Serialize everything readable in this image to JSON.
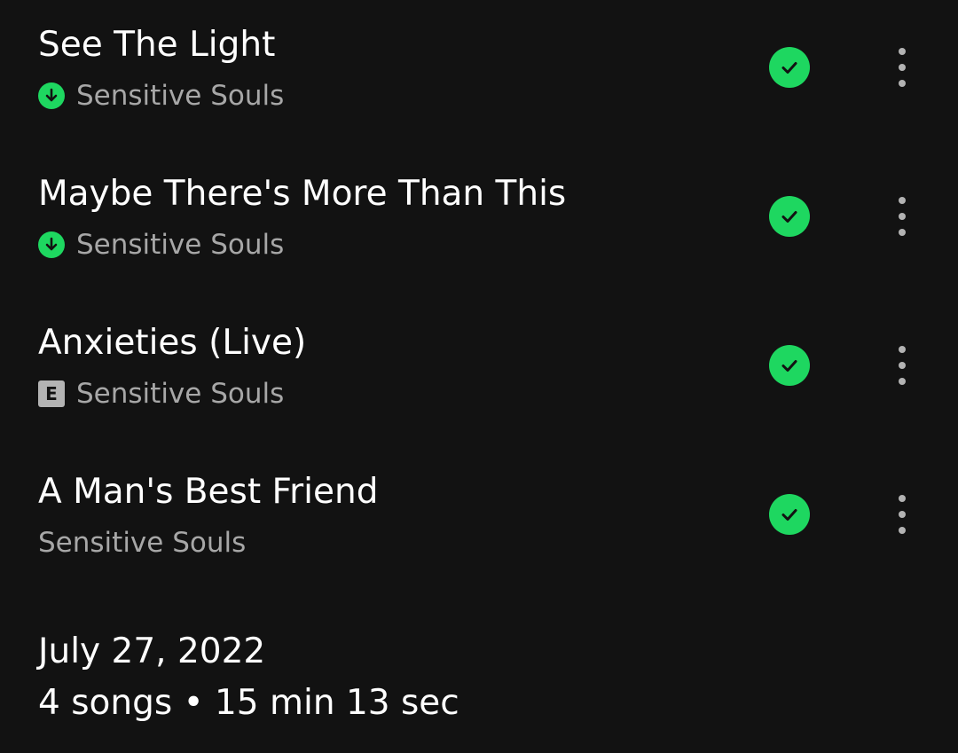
{
  "tracks": [
    {
      "title": "See The Light",
      "artist": "Sensitive Souls",
      "badge": "download",
      "saved": true
    },
    {
      "title": "Maybe There's More Than This",
      "artist": "Sensitive Souls",
      "badge": "download",
      "saved": true
    },
    {
      "title": "Anxieties (Live)",
      "artist": "Sensitive Souls",
      "badge": "explicit",
      "badge_text": "E",
      "saved": true
    },
    {
      "title": "A Man's Best Friend",
      "artist": "Sensitive Souls",
      "badge": "none",
      "saved": true
    }
  ],
  "footer": {
    "date": "July 27, 2022",
    "stats": "4 songs • 15 min 13 sec"
  },
  "icons": {
    "download": "download-arrow-icon",
    "explicit": "explicit-badge-icon",
    "saved": "saved-check-icon",
    "more": "more-options-icon"
  },
  "colors": {
    "background": "#121212",
    "accent": "#1ed760",
    "title": "#ffffff",
    "subtitle": "#a7a7a7"
  }
}
